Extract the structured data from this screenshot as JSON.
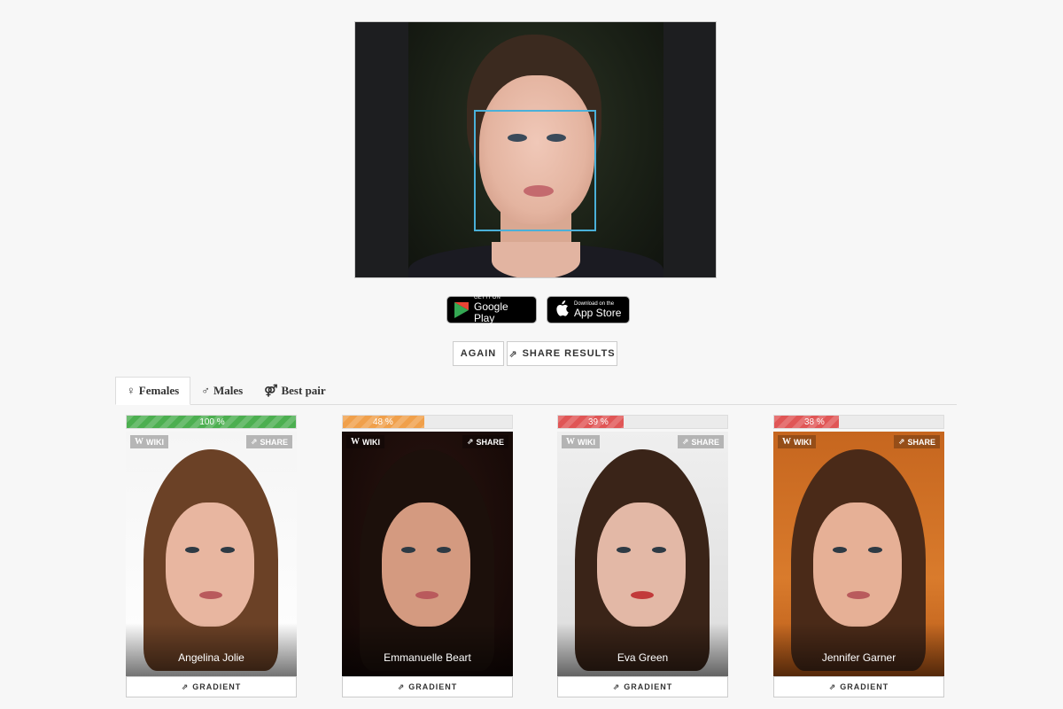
{
  "hero": {
    "image": "uploaded-face-photo",
    "detection_color": "#4ab0d9"
  },
  "stores": {
    "google_play": {
      "small": "GET IT ON",
      "big": "Google Play",
      "icon": "google-play-icon"
    },
    "app_store": {
      "small": "Download on the",
      "big": "App Store",
      "icon": "apple-icon"
    }
  },
  "actions": {
    "again": "AGAIN",
    "share": "SHARE RESULTS"
  },
  "tabs": [
    {
      "label": "Females",
      "icon": "female-icon",
      "active": true
    },
    {
      "label": "Males",
      "icon": "male-icon",
      "active": false
    },
    {
      "label": "Best pair",
      "icon": "pair-icon",
      "active": false
    }
  ],
  "colors": {
    "green": "#4caf50",
    "orange": "#f0a04b",
    "red": "#e05656"
  },
  "results": [
    {
      "percent_text": "100 %",
      "percent": 100,
      "color": "#4caf50",
      "name": "Angelina Jolie",
      "wiki": "WIKI",
      "share": "SHARE",
      "gradient": "GRADIENT"
    },
    {
      "percent_text": "48 %",
      "percent": 48,
      "color": "#f0a04b",
      "name": "Emmanuelle Beart",
      "wiki": "WIKI",
      "share": "SHARE",
      "gradient": "GRADIENT"
    },
    {
      "percent_text": "39 %",
      "percent": 39,
      "color": "#e05656",
      "name": "Eva Green",
      "wiki": "WIKI",
      "share": "SHARE",
      "gradient": "GRADIENT"
    },
    {
      "percent_text": "38 %",
      "percent": 38,
      "color": "#e05656",
      "name": "Jennifer Garner",
      "wiki": "WIKI",
      "share": "SHARE",
      "gradient": "GRADIENT"
    }
  ]
}
